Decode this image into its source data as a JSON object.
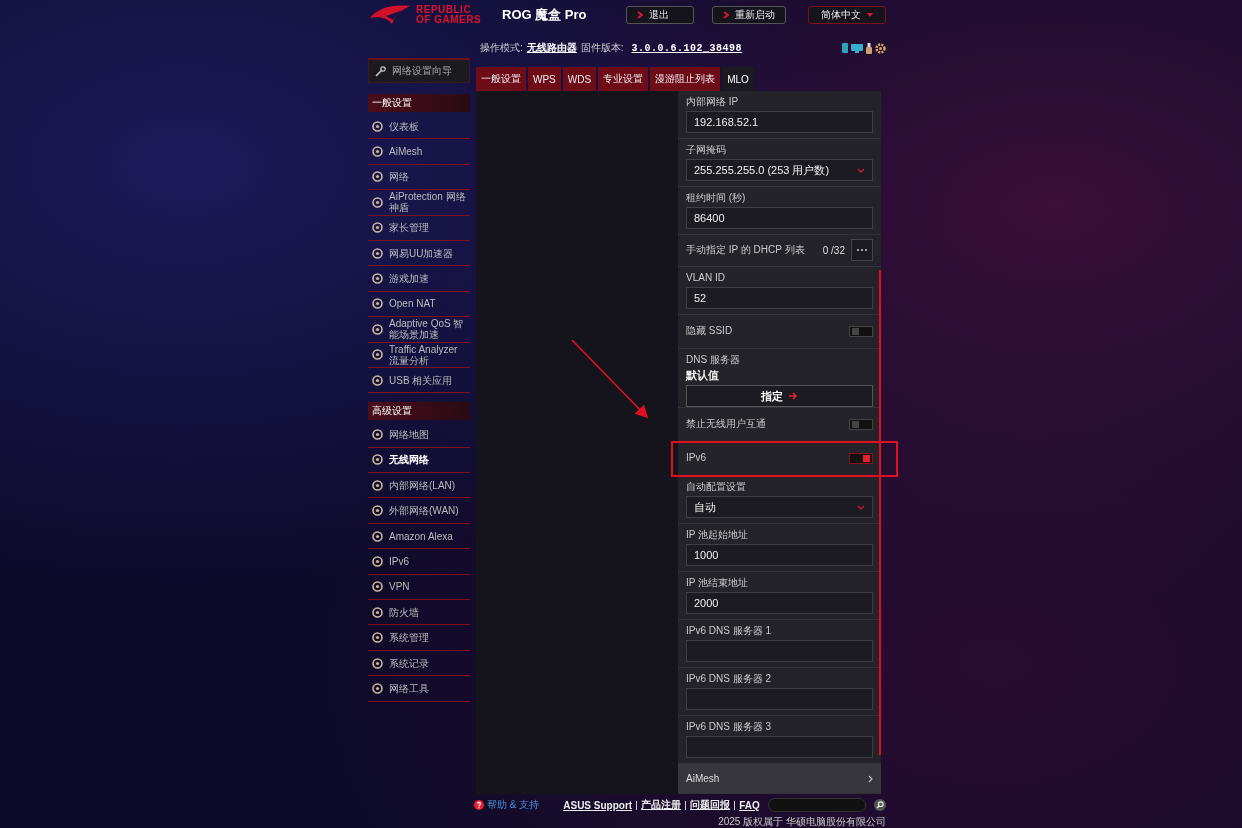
{
  "header": {
    "brand": "REPUBLIC OF GAMERS",
    "title": "ROG 魔盒 Pro",
    "buttons": [
      "退出",
      "重新启动"
    ],
    "language": "简体中文"
  },
  "status": {
    "mode_label": "操作模式:",
    "mode": "无线路由器",
    "firmware_label": "固件版本:",
    "firmware": "3.0.0.6.102_38498"
  },
  "sidebar": {
    "wizard": "网络设置向导",
    "sections": [
      {
        "title": "一般设置",
        "items": [
          {
            "label": "仪表板",
            "selected": false
          },
          {
            "label": "AiMesh",
            "selected": false
          },
          {
            "label": "网络",
            "selected": false
          },
          {
            "label": "AiProtection 网络神盾",
            "selected": false
          },
          {
            "label": "家长管理",
            "selected": false
          },
          {
            "label": "网易UU加速器",
            "selected": false
          },
          {
            "label": "游戏加速",
            "selected": false
          },
          {
            "label": "Open NAT",
            "selected": false
          },
          {
            "label": "Adaptive QoS 智能场景加速",
            "selected": false
          },
          {
            "label": "Traffic Analyzer 流量分析",
            "selected": false
          },
          {
            "label": "USB 相关应用",
            "selected": false
          }
        ]
      },
      {
        "title": "高级设置",
        "items": [
          {
            "label": "网络地图",
            "selected": false
          },
          {
            "label": "无线网络",
            "selected": true
          },
          {
            "label": "内部网络(LAN)",
            "selected": false
          },
          {
            "label": "外部网络(WAN)",
            "selected": false
          },
          {
            "label": "Amazon Alexa",
            "selected": false
          },
          {
            "label": "IPv6",
            "selected": false
          },
          {
            "label": "VPN",
            "selected": false
          },
          {
            "label": "防火墙",
            "selected": false
          },
          {
            "label": "系统管理",
            "selected": false
          },
          {
            "label": "系统记录",
            "selected": false
          },
          {
            "label": "网络工具",
            "selected": false
          }
        ]
      }
    ]
  },
  "tabs": [
    {
      "label": "一般设置",
      "selected": false
    },
    {
      "label": "WPS",
      "selected": false
    },
    {
      "label": "WDS",
      "selected": false
    },
    {
      "label": "专业设置",
      "selected": false
    },
    {
      "label": "漫游阻止列表",
      "selected": false
    },
    {
      "label": "MLO",
      "selected": true
    }
  ],
  "settings": [
    {
      "kind": "input",
      "label": "内部网络 IP",
      "value": "192.168.52.1",
      "highlighted": false
    },
    {
      "kind": "select",
      "label": "子网掩码",
      "value": "255.255.255.0 (253 用户数)",
      "highlighted": false
    },
    {
      "kind": "input",
      "label": "租约时间 (秒)",
      "value": "86400",
      "highlighted": false
    },
    {
      "kind": "list",
      "label": "手动指定 IP 的 DHCP 列表",
      "count": "0 /32",
      "highlighted": false
    },
    {
      "kind": "input",
      "label": "VLAN ID",
      "value": "52",
      "highlighted": false
    },
    {
      "kind": "toggle",
      "label": "隐藏 SSID",
      "on": false,
      "highlighted": false
    },
    {
      "kind": "dns",
      "label": "DNS 服务器",
      "value": "默认值",
      "button": "指定",
      "highlighted": false
    },
    {
      "kind": "toggle",
      "label": "禁止无线用户互通",
      "on": false,
      "highlighted": false
    },
    {
      "kind": "toggle",
      "label": "IPv6",
      "on": true,
      "highlighted": true
    },
    {
      "kind": "select",
      "label": "自动配置设置",
      "value": "自动",
      "highlighted": false
    },
    {
      "kind": "input",
      "label": "IP 池起始地址",
      "value": "1000",
      "highlighted": false
    },
    {
      "kind": "input",
      "label": "IP 池结束地址",
      "value": "2000",
      "highlighted": false
    },
    {
      "kind": "input",
      "label": "IPv6 DNS 服务器 1",
      "highlighted": false
    },
    {
      "kind": "input",
      "label": "IPv6 DNS 服务器 2",
      "highlighted": false
    },
    {
      "kind": "input",
      "label": "IPv6 DNS 服务器 3",
      "highlighted": false
    },
    {
      "kind": "link",
      "label": "AiMesh",
      "highlighted": false
    }
  ],
  "footer": {
    "help": "帮助 & 支持",
    "links": [
      "ASUS Support",
      "产品注册",
      "问题回报",
      "FAQ"
    ],
    "copyright": "2025 版权属于 华硕电脑股份有限公司"
  }
}
